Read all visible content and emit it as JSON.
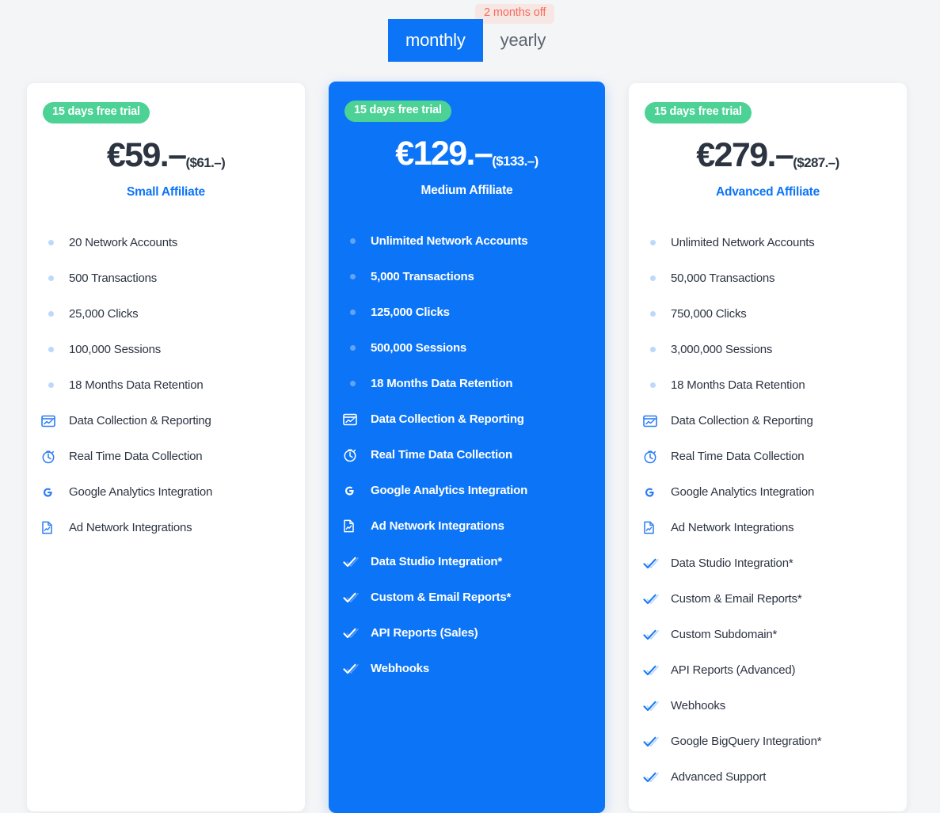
{
  "billing_toggle": {
    "discount_badge": "2 months off",
    "options": [
      {
        "label": "monthly",
        "active": true
      },
      {
        "label": "yearly",
        "active": false
      }
    ],
    "active_color": "#0c74f7",
    "badge_text_color": "#fa6a5a",
    "badge_bg_color": "#f6e7e4"
  },
  "accent_color": "#0c74f7",
  "trial_badge_color": "#4cd295",
  "plans": [
    {
      "trial_badge": "15 days free trial",
      "price": "€59.–",
      "price_alt": "($61.–)",
      "name": "Small Affiliate",
      "highlighted": false,
      "features": [
        {
          "icon": "dot-icon",
          "label": "20 Network Accounts"
        },
        {
          "icon": "dot-icon",
          "label": "500 Transactions"
        },
        {
          "icon": "dot-icon",
          "label": "25,000 Clicks"
        },
        {
          "icon": "dot-icon",
          "label": "100,000 Sessions"
        },
        {
          "icon": "dot-icon",
          "label": "18 Months Data Retention"
        },
        {
          "icon": "chart-window-icon",
          "label": "Data Collection & Reporting"
        },
        {
          "icon": "stopwatch-icon",
          "label": "Real Time Data Collection"
        },
        {
          "icon": "google-g-icon",
          "label": "Google Analytics Integration"
        },
        {
          "icon": "document-chart-icon",
          "label": "Ad Network Integrations"
        }
      ]
    },
    {
      "trial_badge": "15 days free trial",
      "price": "€129.–",
      "price_alt": "($133.–)",
      "name": "Medium Affiliate",
      "highlighted": true,
      "features": [
        {
          "icon": "dot-icon",
          "label": "Unlimited Network Accounts"
        },
        {
          "icon": "dot-icon",
          "label": "5,000 Transactions"
        },
        {
          "icon": "dot-icon",
          "label": "125,000 Clicks"
        },
        {
          "icon": "dot-icon",
          "label": "500,000 Sessions"
        },
        {
          "icon": "dot-icon",
          "label": "18 Months Data Retention"
        },
        {
          "icon": "chart-window-icon",
          "label": "Data Collection & Reporting"
        },
        {
          "icon": "stopwatch-icon",
          "label": "Real Time Data Collection"
        },
        {
          "icon": "google-g-icon",
          "label": "Google Analytics Integration"
        },
        {
          "icon": "document-chart-icon",
          "label": "Ad Network Integrations"
        },
        {
          "icon": "check-icon",
          "label": "Data Studio Integration*"
        },
        {
          "icon": "check-icon",
          "label": "Custom & Email Reports*"
        },
        {
          "icon": "check-icon",
          "label": "API Reports (Sales)"
        },
        {
          "icon": "check-icon",
          "label": "Webhooks"
        }
      ]
    },
    {
      "trial_badge": "15 days free trial",
      "price": "€279.–",
      "price_alt": "($287.–)",
      "name": "Advanced Affiliate",
      "highlighted": false,
      "features": [
        {
          "icon": "dot-icon",
          "label": "Unlimited Network Accounts"
        },
        {
          "icon": "dot-icon",
          "label": "50,000 Transactions"
        },
        {
          "icon": "dot-icon",
          "label": "750,000 Clicks"
        },
        {
          "icon": "dot-icon",
          "label": "3,000,000 Sessions"
        },
        {
          "icon": "dot-icon",
          "label": "18 Months Data Retention"
        },
        {
          "icon": "chart-window-icon",
          "label": "Data Collection & Reporting"
        },
        {
          "icon": "stopwatch-icon",
          "label": "Real Time Data Collection"
        },
        {
          "icon": "google-g-icon",
          "label": "Google Analytics Integration"
        },
        {
          "icon": "document-chart-icon",
          "label": "Ad Network Integrations"
        },
        {
          "icon": "check-icon",
          "label": "Data Studio Integration*"
        },
        {
          "icon": "check-icon",
          "label": "Custom & Email Reports*"
        },
        {
          "icon": "check-icon",
          "label": "Custom Subdomain*"
        },
        {
          "icon": "check-icon",
          "label": "API Reports (Advanced)"
        },
        {
          "icon": "check-icon",
          "label": "Webhooks"
        },
        {
          "icon": "check-icon",
          "label": "Google BigQuery Integration*"
        },
        {
          "icon": "check-icon",
          "label": "Advanced Support"
        }
      ]
    }
  ]
}
